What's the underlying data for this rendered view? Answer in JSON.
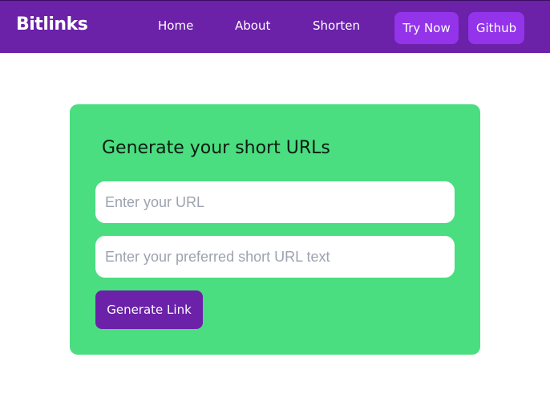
{
  "nav": {
    "brand": "Bitlinks",
    "links": [
      {
        "label": "Home"
      },
      {
        "label": "About"
      },
      {
        "label": "Shorten"
      }
    ],
    "try_now_label": "Try Now",
    "github_label": "Github"
  },
  "card": {
    "title": "Generate your short URLs",
    "url_placeholder": "Enter your URL",
    "url_value": "",
    "short_placeholder": "Enter your preferred short URL text",
    "short_value": "",
    "button_label": "Generate Link"
  },
  "colors": {
    "navbar": "#6b21a8",
    "nav_button": "#9333ea",
    "card": "#4ade80",
    "generate_button": "#6b21a8"
  }
}
